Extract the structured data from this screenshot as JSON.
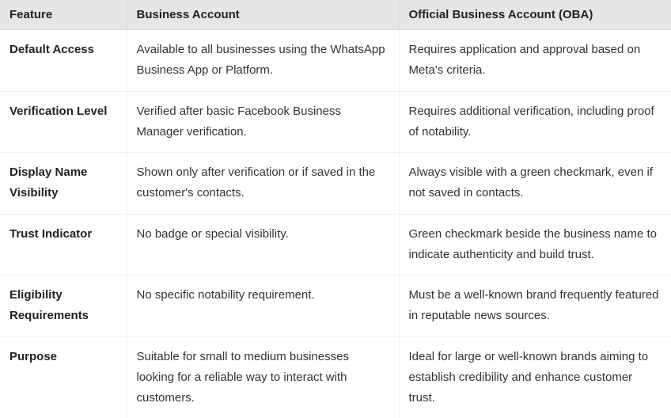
{
  "table": {
    "headers": {
      "feature": "Feature",
      "business": "Business Account",
      "oba": "Official Business Account (OBA)"
    },
    "rows": [
      {
        "feature": "Default Access",
        "business": "Available to all businesses using the WhatsApp Business App or Platform.",
        "oba": "Requires application and approval based on Meta's criteria."
      },
      {
        "feature": "Verification Level",
        "business": "Verified after basic Facebook Business Manager verification.",
        "oba": "Requires additional verification, including proof of notability."
      },
      {
        "feature": "Display Name Visibility",
        "business": "Shown only after verification or if saved in the customer's contacts.",
        "oba": "Always visible with a green checkmark, even if not saved in contacts."
      },
      {
        "feature": "Trust Indicator",
        "business": "No badge or special visibility.",
        "oba": "Green checkmark beside the business name to indicate authenticity and build trust."
      },
      {
        "feature": "Eligibility Requirements",
        "business": "No specific notability requirement.",
        "oba": "Must be a well-known brand frequently featured in reputable news sources."
      },
      {
        "feature": "Purpose",
        "business": "Suitable for small to medium businesses looking for a reliable way to interact with customers.",
        "oba": "Ideal for large or well-known brands aiming to establish credibility and enhance customer trust."
      }
    ]
  }
}
